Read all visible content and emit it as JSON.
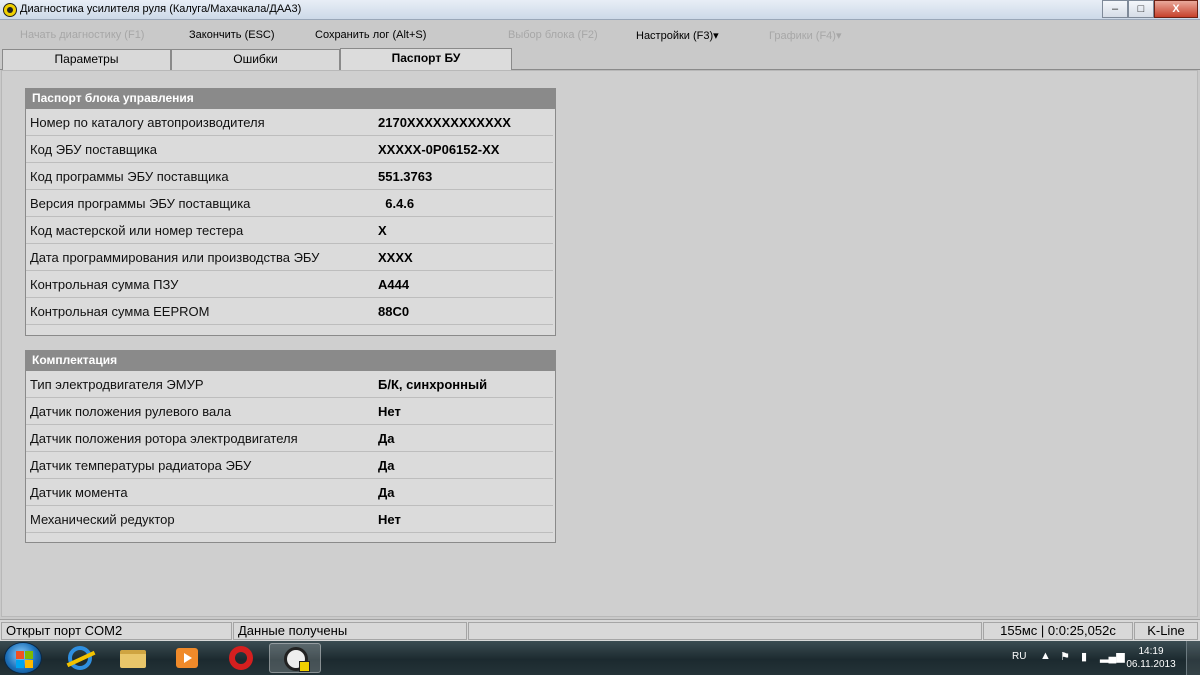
{
  "window": {
    "title": "Диагностика усилителя руля (Калуга/Махачкала/ДАА3)",
    "minimize": "–",
    "maximize": "□",
    "close": "X"
  },
  "toolbar": {
    "start_diag": "Начать диагностику (F1)",
    "finish": "Закончить (ESC)",
    "save_log": "Сохранить лог (Alt+S)",
    "select_unit": "Выбор блока (F2)",
    "settings": "Настройки (F3)",
    "graphs": "Графики (F4)",
    "dropdown_arrow": "▾"
  },
  "tabs": [
    {
      "label": "Параметры",
      "active": false
    },
    {
      "label": "Ошибки",
      "active": false
    },
    {
      "label": "Паспорт БУ",
      "active": true
    }
  ],
  "passport": {
    "header": "Паспорт блока управления",
    "rows": [
      {
        "label": "Номер по каталогу автопроизводителя",
        "value": "2170XXXXXXXXXXXX"
      },
      {
        "label": "Код ЭБУ поставщика",
        "value": "XXXXX-0P06152-XX"
      },
      {
        "label": "Код программы ЭБУ поставщика",
        "value": "551.3763"
      },
      {
        "label": "Версия программы ЭБУ поставщика",
        "value": "  6.4.6"
      },
      {
        "label": "Код мастерской или номер тестера",
        "value": "X"
      },
      {
        "label": "Дата программирования или производства ЭБУ",
        "value": "XXXX"
      },
      {
        "label": "Контрольная сумма ПЗУ",
        "value": "A444"
      },
      {
        "label": "Контрольная сумма EEPROM",
        "value": "88C0"
      }
    ]
  },
  "equipment": {
    "header": "Комплектация",
    "rows": [
      {
        "label": "Тип электродвигателя ЭМУР",
        "value": "Б/К, синхронный"
      },
      {
        "label": "Датчик положения рулевого вала",
        "value": "Нет"
      },
      {
        "label": "Датчик положения ротора электродвигателя",
        "value": "Да"
      },
      {
        "label": "Датчик температуры радиатора ЭБУ",
        "value": "Да"
      },
      {
        "label": "Датчик момента",
        "value": "Да"
      },
      {
        "label": "Механический редуктор",
        "value": "Нет"
      }
    ]
  },
  "statusbar": {
    "port": "Открыт порт COM2",
    "data": "Данные получены",
    "empty": "",
    "timing": "155мс | 0:0:25,052с",
    "protocol": "K-Line"
  },
  "taskbar": {
    "lang": "RU",
    "time": "14:19",
    "date": "06.11.2013"
  }
}
